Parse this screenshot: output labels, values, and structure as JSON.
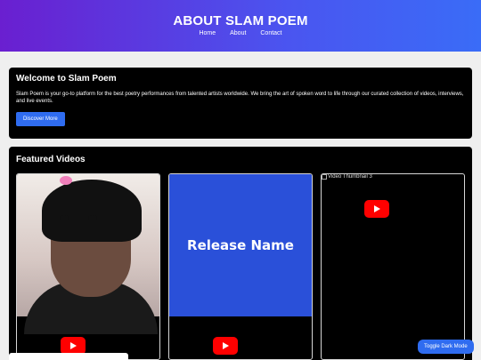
{
  "header": {
    "title": "ABOUT SLAM POEM",
    "nav": [
      "Home",
      "About",
      "Contact"
    ]
  },
  "welcome": {
    "title": "Welcome to Slam Poem",
    "text": "Slam Poem is your go-to platform for the best poetry performances from talented artists worldwide. We bring the art of spoken word to life through our curated collection of videos, interviews, and live events.",
    "button": "Discover More"
  },
  "featured": {
    "title": "Featured Videos",
    "videos": [
      {
        "thumb_text": ""
      },
      {
        "thumb_text": "Release Name"
      },
      {
        "alt_text": "Video Thumbnail 3"
      }
    ]
  },
  "toggle": "Toggle Dark Mode",
  "colors": {
    "accent": "#2f6cf0",
    "play": "#ff0000",
    "panel": "#000000"
  }
}
